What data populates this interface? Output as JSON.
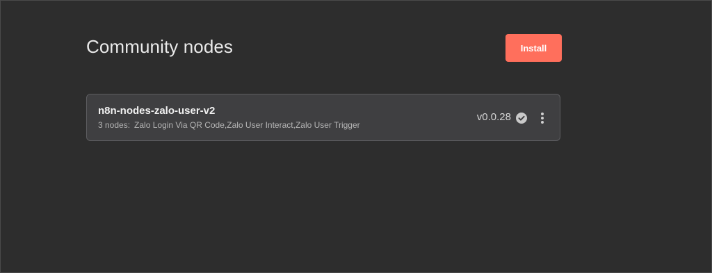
{
  "header": {
    "title": "Community nodes",
    "install_label": "Install"
  },
  "packages": [
    {
      "name": "n8n-nodes-zalo-user-v2",
      "node_count": "3 nodes:",
      "node_list": "Zalo Login Via QR Code,Zalo User Interact,Zalo User Trigger",
      "version": "v0.0.28",
      "verified_icon": "check-circle-icon",
      "menu_icon": "more-vertical-icon"
    }
  ],
  "colors": {
    "background": "#2d2d2d",
    "card": "#3f3f41",
    "accent": "#ff6f5c"
  }
}
